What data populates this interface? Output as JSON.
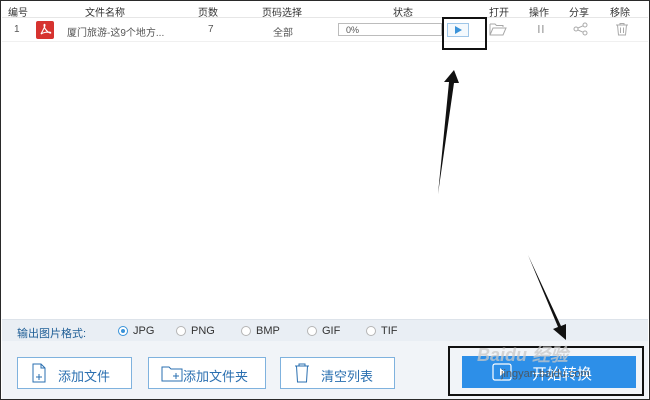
{
  "columns": {
    "index": "编号",
    "filename": "文件名称",
    "pages": "页数",
    "page_select": "页码选择",
    "status": "状态",
    "open": "打开",
    "operate": "操作",
    "share": "分享",
    "remove": "移除"
  },
  "files": [
    {
      "index": "1",
      "filename": "厦门旅游-这9个地方...",
      "pages": "7",
      "page_select": "全部",
      "progress_text": "0%",
      "progress": 0
    }
  ],
  "format_bar": {
    "label": "输出图片格式:",
    "options": [
      "JPG",
      "PNG",
      "BMP",
      "GIF",
      "TIF"
    ],
    "selected": "JPG"
  },
  "buttons": {
    "add_file": "添加文件",
    "add_folder": "添加文件夹",
    "clear_list": "清空列表",
    "start": "开始转换"
  },
  "watermark": {
    "brand": "Baidu 经验",
    "url": "jingyan.baidu.com"
  },
  "colors": {
    "accent": "#2d8fe8",
    "pdf_red": "#d6332f",
    "label_blue": "#1f5e96",
    "annotation": "#111111"
  },
  "icons": {
    "file": "pdf-icon",
    "open": "folder-icon",
    "operate": "pause-icon",
    "share": "share-icon",
    "remove": "trash-icon",
    "play": "play-icon"
  }
}
